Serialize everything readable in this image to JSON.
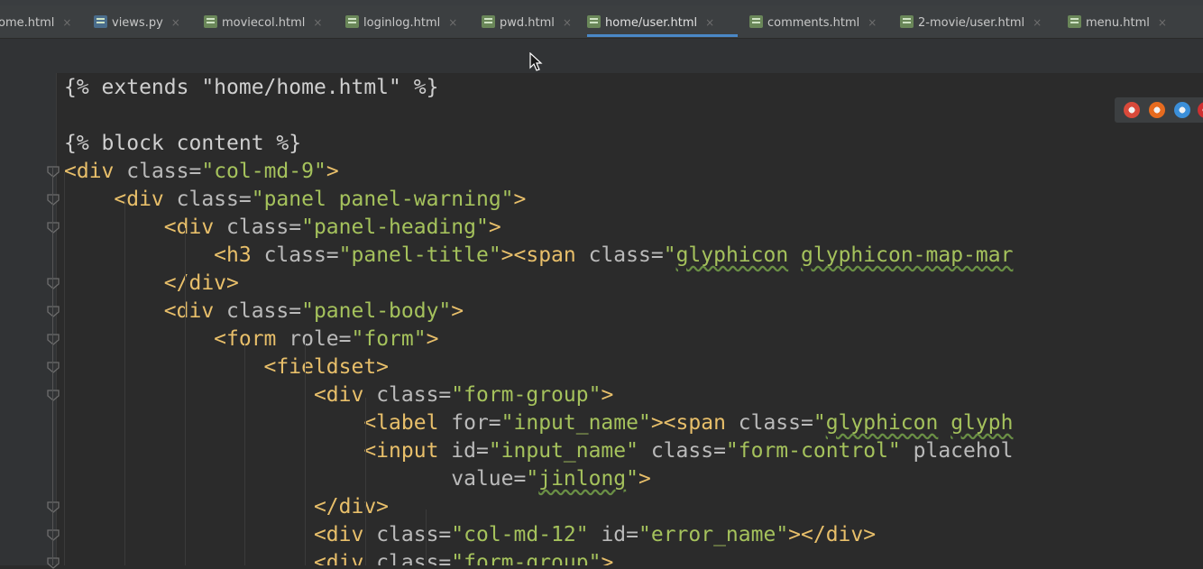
{
  "tabs": [
    {
      "label": "ome.html",
      "icon": "html-file-icon",
      "active": false
    },
    {
      "label": "views.py",
      "icon": "python-file-icon",
      "active": false
    },
    {
      "label": "moviecol.html",
      "icon": "html-file-icon",
      "active": false
    },
    {
      "label": "loginlog.html",
      "icon": "html-file-icon",
      "active": false
    },
    {
      "label": "pwd.html",
      "icon": "html-file-icon",
      "active": false
    },
    {
      "label": "home/user.html",
      "icon": "html-file-icon",
      "active": true
    },
    {
      "label": "comments.html",
      "icon": "html-file-icon",
      "active": false
    },
    {
      "label": "2-movie/user.html",
      "icon": "html-file-icon",
      "active": false
    },
    {
      "label": "menu.html",
      "icon": "html-file-icon",
      "active": false
    }
  ],
  "tab_close_glyph": "×",
  "browser_icons": [
    "chrome-icon",
    "firefox-icon",
    "safari-icon",
    "opera-icon"
  ],
  "editor": {
    "lines": [
      [
        {
          "t": "tpl",
          "v": "{% extends \"home/home.html\" %}"
        }
      ],
      [],
      [
        {
          "t": "tpl",
          "v": "{% block content %}"
        }
      ],
      [
        {
          "t": "tag",
          "v": "<div "
        },
        {
          "t": "attr",
          "v": "class="
        },
        {
          "t": "str",
          "v": "\"col-md-9\""
        },
        {
          "t": "tag",
          "v": ">"
        }
      ],
      [
        {
          "t": "tag",
          "v": "    <div "
        },
        {
          "t": "attr",
          "v": "class="
        },
        {
          "t": "str",
          "v": "\"panel panel-warning\""
        },
        {
          "t": "tag",
          "v": ">"
        }
      ],
      [
        {
          "t": "tag",
          "v": "        <div "
        },
        {
          "t": "attr",
          "v": "class="
        },
        {
          "t": "str",
          "v": "\"panel-heading\""
        },
        {
          "t": "tag",
          "v": ">"
        }
      ],
      [
        {
          "t": "tag",
          "v": "            <h3 "
        },
        {
          "t": "attr",
          "v": "class="
        },
        {
          "t": "str",
          "v": "\"panel-title\""
        },
        {
          "t": "tag",
          "v": "><span "
        },
        {
          "t": "attr",
          "v": "class="
        },
        {
          "t": "str",
          "v": "\""
        },
        {
          "t": "str typo",
          "v": "glyphicon"
        },
        {
          "t": "str",
          "v": " "
        },
        {
          "t": "str typo",
          "v": "glyphicon-map-mar"
        }
      ],
      [
        {
          "t": "tag",
          "v": "        </div>"
        }
      ],
      [
        {
          "t": "tag",
          "v": "        <div "
        },
        {
          "t": "attr",
          "v": "class="
        },
        {
          "t": "str",
          "v": "\"panel-body\""
        },
        {
          "t": "tag",
          "v": ">"
        }
      ],
      [
        {
          "t": "tag",
          "v": "            <form "
        },
        {
          "t": "attr",
          "v": "role="
        },
        {
          "t": "str",
          "v": "\"form\""
        },
        {
          "t": "tag",
          "v": ">"
        }
      ],
      [
        {
          "t": "tag",
          "v": "                <fieldset>"
        }
      ],
      [
        {
          "t": "tag",
          "v": "                    <div "
        },
        {
          "t": "attr",
          "v": "class="
        },
        {
          "t": "str",
          "v": "\"form-group\""
        },
        {
          "t": "tag",
          "v": ">"
        }
      ],
      [
        {
          "t": "tag",
          "v": "                        <label "
        },
        {
          "t": "attr",
          "v": "for="
        },
        {
          "t": "str",
          "v": "\"input_name\""
        },
        {
          "t": "tag",
          "v": "><span "
        },
        {
          "t": "attr",
          "v": "class="
        },
        {
          "t": "str",
          "v": "\""
        },
        {
          "t": "str typo",
          "v": "glyphicon"
        },
        {
          "t": "str",
          "v": " "
        },
        {
          "t": "str typo",
          "v": "glyph"
        }
      ],
      [
        {
          "t": "tag",
          "v": "                        <input "
        },
        {
          "t": "attr",
          "v": "id="
        },
        {
          "t": "str",
          "v": "\"input_name\" "
        },
        {
          "t": "attr",
          "v": "class="
        },
        {
          "t": "str",
          "v": "\"form-control\" "
        },
        {
          "t": "attr",
          "v": "placehol"
        }
      ],
      [
        {
          "t": "attr",
          "v": "                               value="
        },
        {
          "t": "str",
          "v": "\""
        },
        {
          "t": "str typo",
          "v": "jinlong"
        },
        {
          "t": "str",
          "v": "\""
        },
        {
          "t": "tag",
          "v": ">"
        }
      ],
      [
        {
          "t": "tag",
          "v": "                    </div>"
        }
      ],
      [
        {
          "t": "tag",
          "v": "                    <div "
        },
        {
          "t": "attr",
          "v": "class="
        },
        {
          "t": "str",
          "v": "\"col-md-12\" "
        },
        {
          "t": "attr",
          "v": "id="
        },
        {
          "t": "str",
          "v": "\"error_name\""
        },
        {
          "t": "tag",
          "v": "></div>"
        }
      ],
      [
        {
          "t": "tag",
          "v": "                    <div "
        },
        {
          "t": "attr",
          "v": "class="
        },
        {
          "t": "str",
          "v": "\"form-group\""
        },
        {
          "t": "tag",
          "v": ">"
        }
      ]
    ]
  },
  "colors": {
    "background": "#2b2b2b",
    "tag": "#e8bf6a",
    "attribute": "#bababa",
    "string": "#a5c25c",
    "active_tab_underline": "#4a88c7"
  }
}
